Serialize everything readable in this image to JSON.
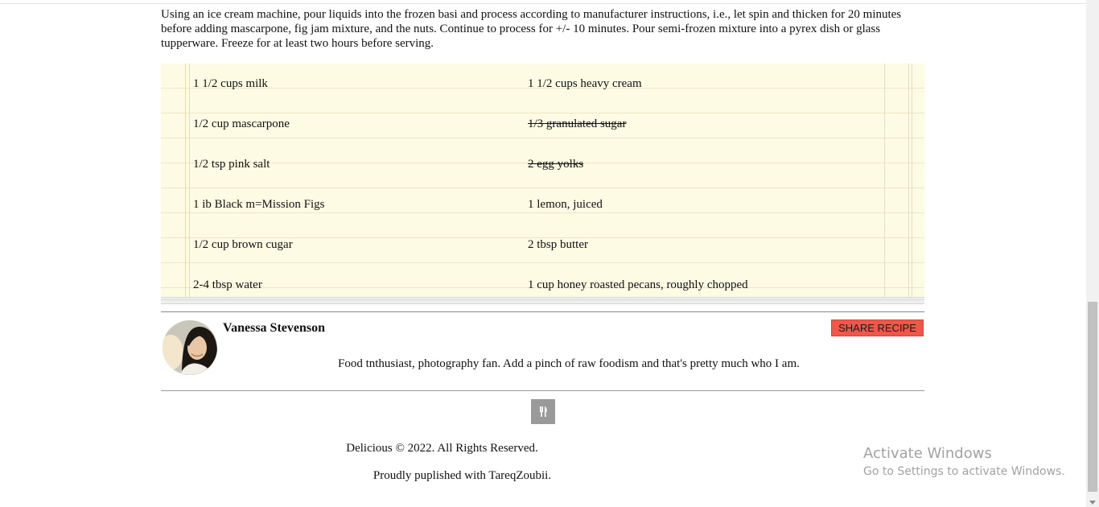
{
  "recipe": {
    "instructions": "Using an ice cream machine, pour liquids into the frozen basi and process according to manufacturer instructions, i.e., let spin and thicken for 20 minutes before adding mascarpone, fig jam mixture, and the nuts. Continue to process for +/- 10 minutes. Pour semi-frozen mixture into a pyrex dish or glass tupperware. Freeze for at least two hours before serving.",
    "ingredients": {
      "left": [
        {
          "text": "1 1/2 cups milk",
          "struck": false
        },
        {
          "text": "1/2 cup mascarpone",
          "struck": false
        },
        {
          "text": "1/2 tsp pink salt",
          "struck": false
        },
        {
          "text": "1 ib Black m=Mission Figs",
          "struck": false
        },
        {
          "text": "1/2 cup brown cugar",
          "struck": false
        },
        {
          "text": "2-4 tbsp water",
          "struck": false
        }
      ],
      "right": [
        {
          "text": "1 1/2 cups heavy cream",
          "struck": false
        },
        {
          "text": "1/3 granulated sugar",
          "struck": true
        },
        {
          "text": "2 egg yolks",
          "struck": true
        },
        {
          "text": "1 lemon, juiced",
          "struck": false
        },
        {
          "text": "2 tbsp butter",
          "struck": false
        },
        {
          "text": "1 cup honey roasted pecans, roughly chopped",
          "struck": false
        }
      ]
    }
  },
  "author": {
    "name": "Vanessa Stevenson",
    "bio": "Food tnthusiast, photography fan. Add a pinch of raw foodism and that's pretty much who I am.",
    "share_label": "SHARE RECIPE"
  },
  "footer": {
    "logo_icon": "fork-knife-icon",
    "copyright": "Delicious © 2022. All Rights Reserved.",
    "published": "Proudly puplished with TareqZoubii."
  },
  "watermark": {
    "title": "Activate Windows",
    "subtitle": "Go to Settings to activate Windows."
  },
  "colors": {
    "paper": "#fefbe5",
    "share_button": "#f0574a",
    "logo_box": "#9a9a9a"
  }
}
